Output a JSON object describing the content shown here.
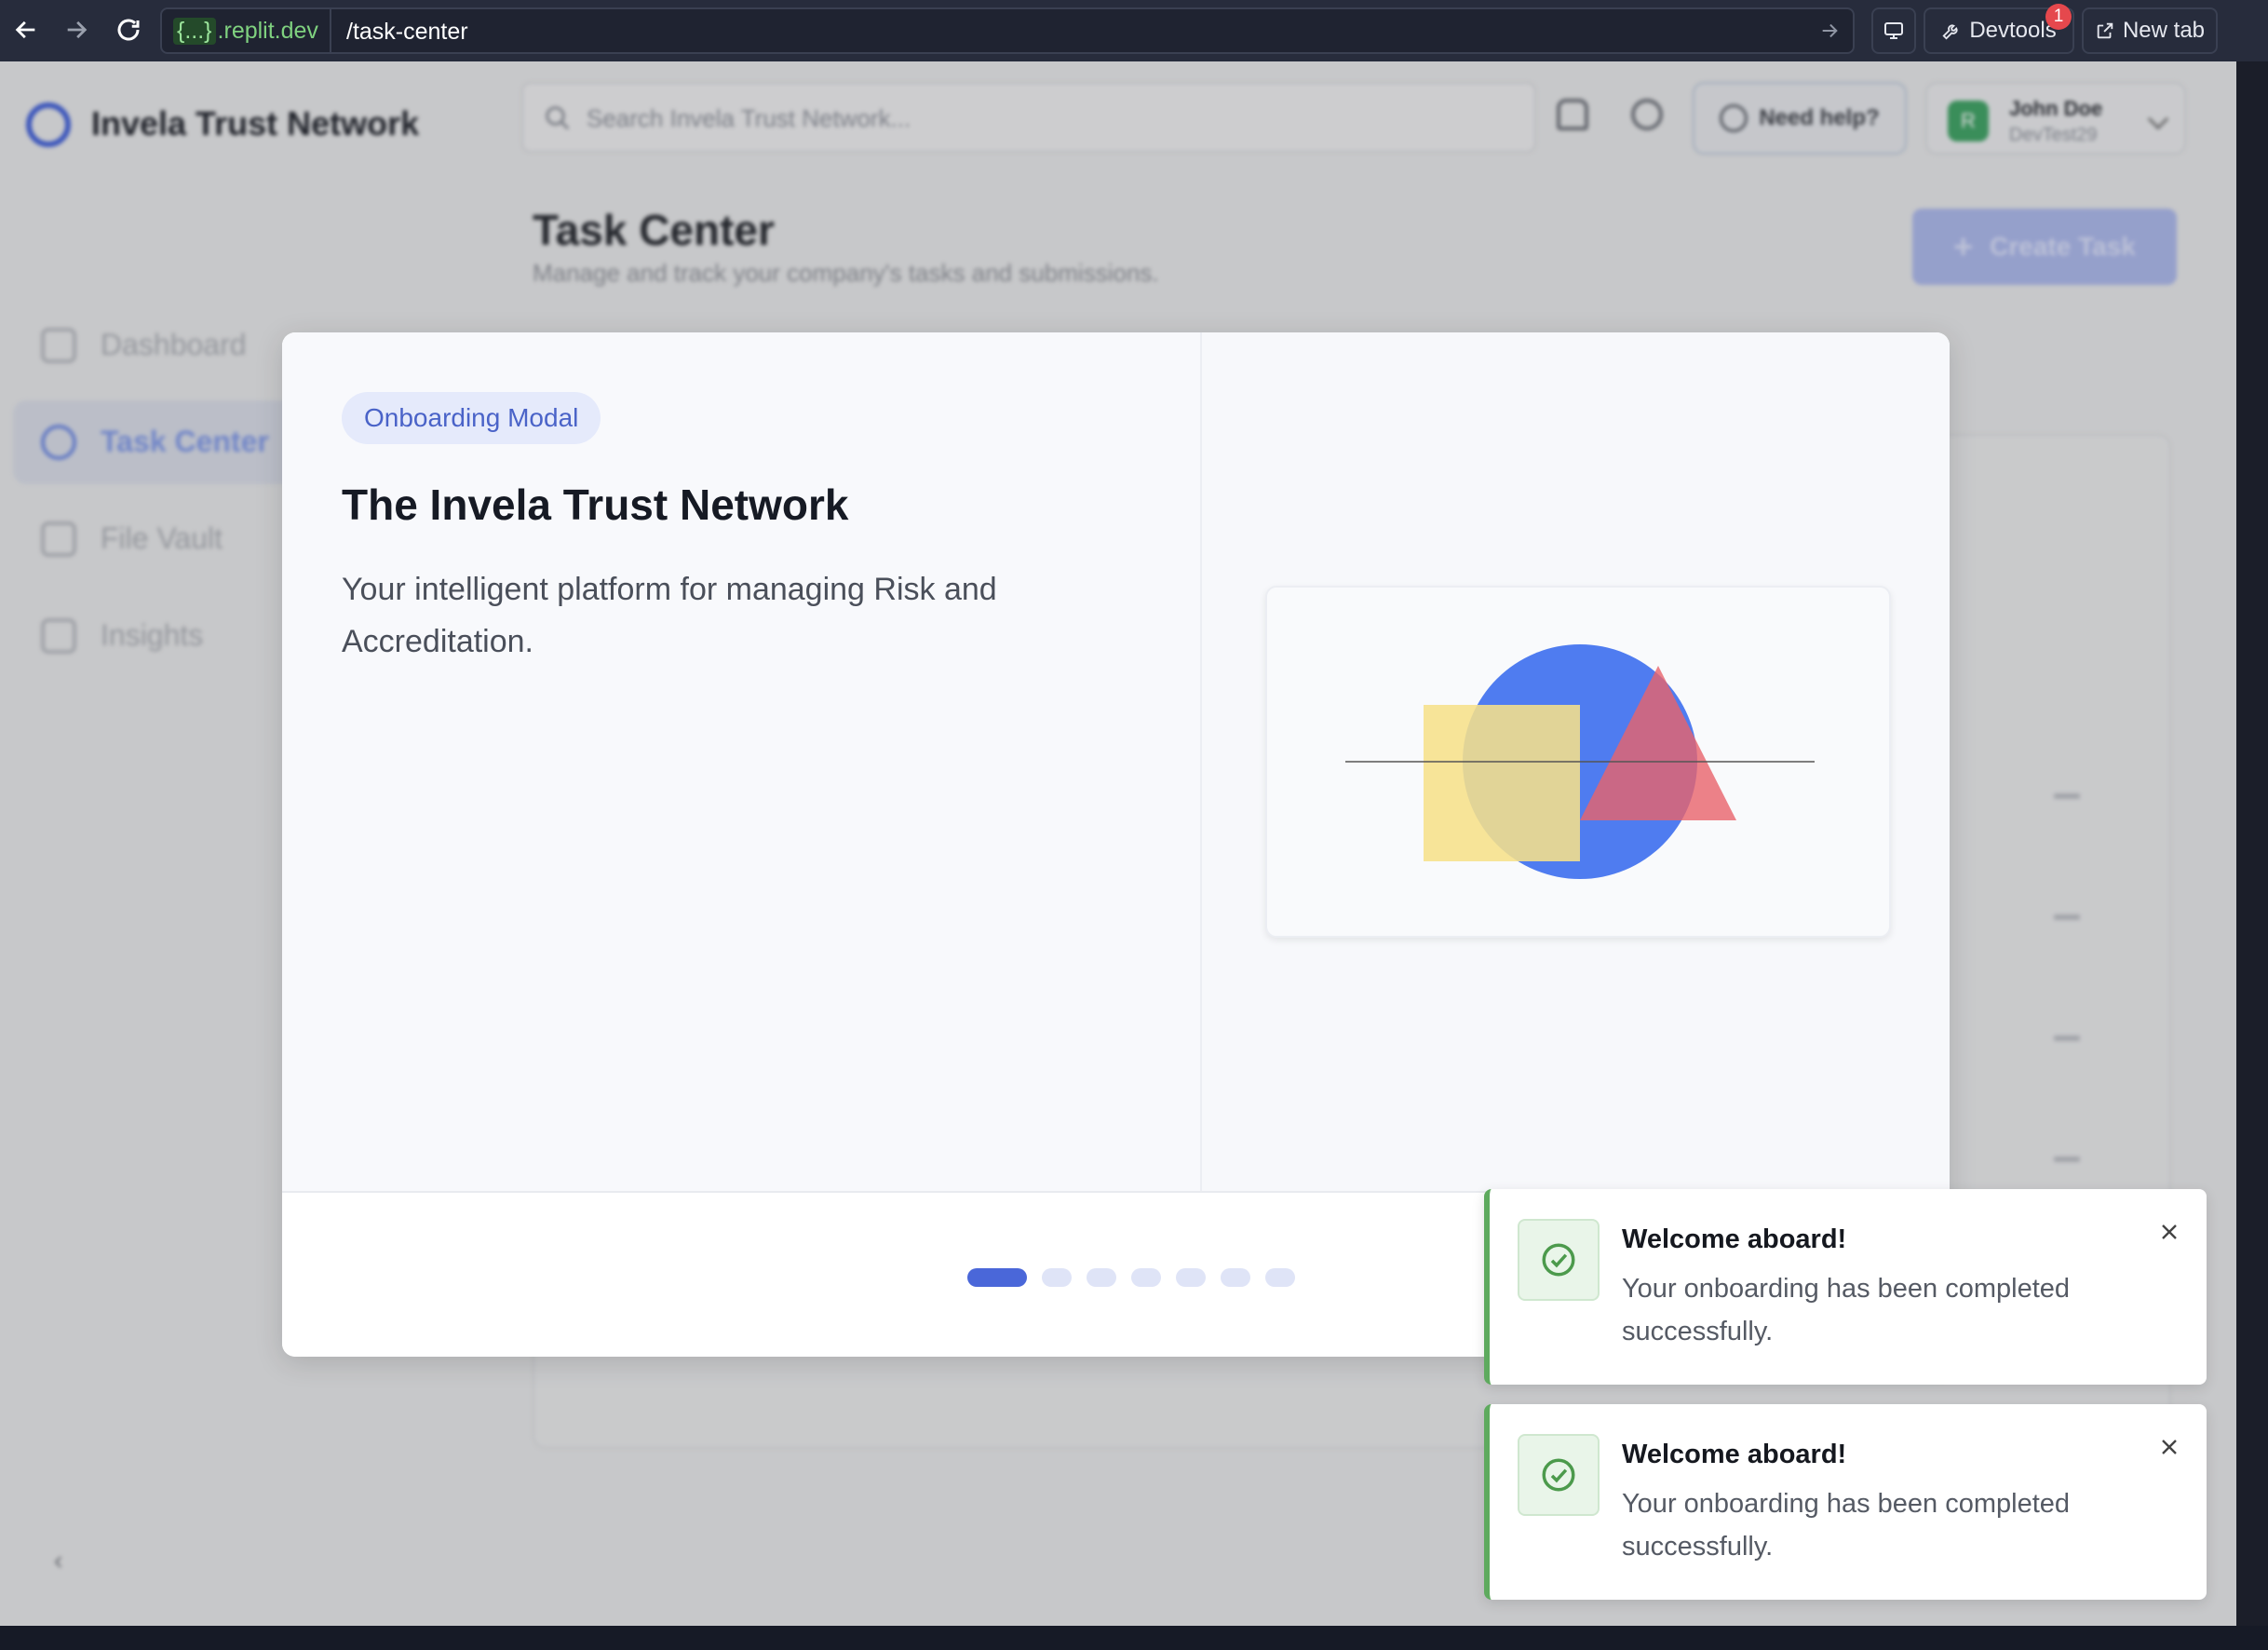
{
  "browser": {
    "url_host_brace": "{...}",
    "url_host": ".replit.dev",
    "url_path": "/task-center",
    "devtools_label": "Devtools",
    "devtools_badge": "1",
    "newtab_label": "New tab"
  },
  "header": {
    "app_title": "Invela Trust Network",
    "search_placeholder": "Search Invela Trust Network...",
    "help_label": "Need help?",
    "user_name": "John Doe",
    "user_sub": "DevTest29",
    "avatar_initial": "R"
  },
  "sidebar": {
    "items": [
      {
        "label": "Dashboard"
      },
      {
        "label": "Task Center"
      },
      {
        "label": "File Vault"
      },
      {
        "label": "Insights"
      }
    ]
  },
  "page": {
    "title": "Task Center",
    "subtitle": "Manage and track your company's tasks and submissions.",
    "create_label": "Create Task"
  },
  "modal": {
    "pill": "Onboarding Modal",
    "title": "The Invela Trust Network",
    "body": "Your intelligent platform for managing Risk and Accreditation.",
    "pager": {
      "total": 7,
      "active": 1
    }
  },
  "toasts": [
    {
      "title": "Welcome aboard!",
      "message": "Your onboarding has been completed successfully."
    },
    {
      "title": "Welcome aboard!",
      "message": "Your onboarding has been completed successfully."
    }
  ],
  "colors": {
    "accent": "#4a67d9",
    "success": "#5eaa5e",
    "illus_circle": "#4f7cf0",
    "illus_square": "#f6e08a",
    "illus_triangle": "#e8636a"
  }
}
